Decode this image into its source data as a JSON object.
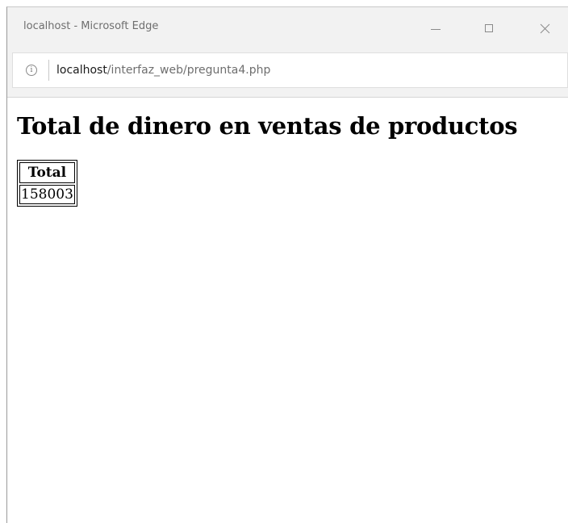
{
  "window": {
    "title": "localhost - Microsoft Edge"
  },
  "address_bar": {
    "host": "localhost",
    "path": "/interfaz_web/pregunta4.php",
    "info_glyph": "i"
  },
  "page": {
    "heading": "Total de dinero en ventas de productos",
    "table": {
      "columns": [
        "Total"
      ],
      "rows": [
        [
          "158003"
        ]
      ]
    }
  },
  "icons": {
    "minimize": "minimize-icon",
    "maximize": "maximize-icon",
    "close": "close-icon",
    "info": "info-icon"
  }
}
